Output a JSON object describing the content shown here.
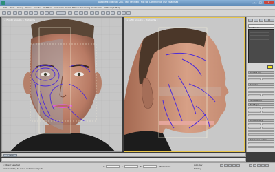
{
  "window": {
    "title": "Autodesk 3ds Max 2011 x64    Untitled - Not for Commercial Use   Final.max",
    "minimize_glyph": "–",
    "maximize_glyph": "□",
    "close_glyph": "×"
  },
  "menubar": {
    "items": [
      "Edit",
      "Tools",
      "Group",
      "Views",
      "Create",
      "Modifiers",
      "Animation",
      "Graph Editors",
      "Rendering",
      "Customize",
      "MAXScript",
      "Help"
    ]
  },
  "viewports": {
    "left_label": "+ Front | Smooth + Highlights ]",
    "right_label": "+ Left | Smooth + Highlights ]"
  },
  "command_panel": {
    "labels": [
      "Modifier List",
      "Editable Poly",
      "Selection",
      "Soft Selection",
      "Edit Edges",
      "Edit Geometry",
      "Subdivision Surface"
    ]
  },
  "timeslider": {
    "label": "0 / 100"
  },
  "status": {
    "line1": "1 Object Selected",
    "line2": "Click and drag to select and move objects",
    "x_label": "X:",
    "y_label": "Y:",
    "z_label": "Z:",
    "grid": "Grid = 10.0",
    "autokey": "Auto Key",
    "setkey": "Set Key"
  },
  "colors": {
    "accent_yellow": "#e8c64a",
    "edge_purple": "#4b2ad9",
    "lip_pink": "#e05adf"
  }
}
